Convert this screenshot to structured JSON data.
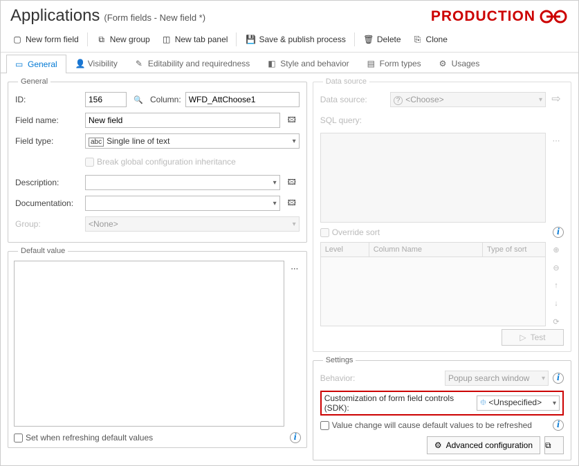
{
  "header": {
    "title": "Applications",
    "breadcrumb": "(Form fields - New field *)",
    "badge": "PRODUCTION"
  },
  "toolbar": {
    "new_form_field": "New form field",
    "new_group": "New group",
    "new_tab_panel": "New tab panel",
    "save_publish": "Save & publish process",
    "delete": "Delete",
    "clone": "Clone"
  },
  "tabs": {
    "general": "General",
    "visibility": "Visibility",
    "editability": "Editability and requiredness",
    "style": "Style and behavior",
    "form_types": "Form types",
    "usages": "Usages"
  },
  "general": {
    "legend": "General",
    "id_label": "ID:",
    "id_value": "156",
    "column_label": "Column:",
    "column_value": "WFD_AttChoose1",
    "field_name_label": "Field name:",
    "field_name_value": "New field",
    "field_type_label": "Field type:",
    "field_type_value": "Single line of text",
    "break_inherit": "Break global configuration inheritance",
    "description_label": "Description:",
    "documentation_label": "Documentation:",
    "group_label": "Group:",
    "group_value": "<None>"
  },
  "default_value": {
    "legend": "Default value",
    "set_refresh": "Set when refreshing default values"
  },
  "data_source": {
    "legend": "Data source",
    "label": "Data source:",
    "value": "<Choose>",
    "sql_label": "SQL query:",
    "override": "Override sort",
    "col_level": "Level",
    "col_name": "Column Name",
    "col_sort": "Type of sort",
    "test": "Test"
  },
  "settings": {
    "legend": "Settings",
    "behavior_label": "Behavior:",
    "behavior_value": "Popup search window",
    "sdk_label": "Customization of form field controls (SDK):",
    "sdk_value": "<Unspecified>",
    "value_change": "Value change will cause default values to be refreshed",
    "advanced": "Advanced configuration"
  }
}
